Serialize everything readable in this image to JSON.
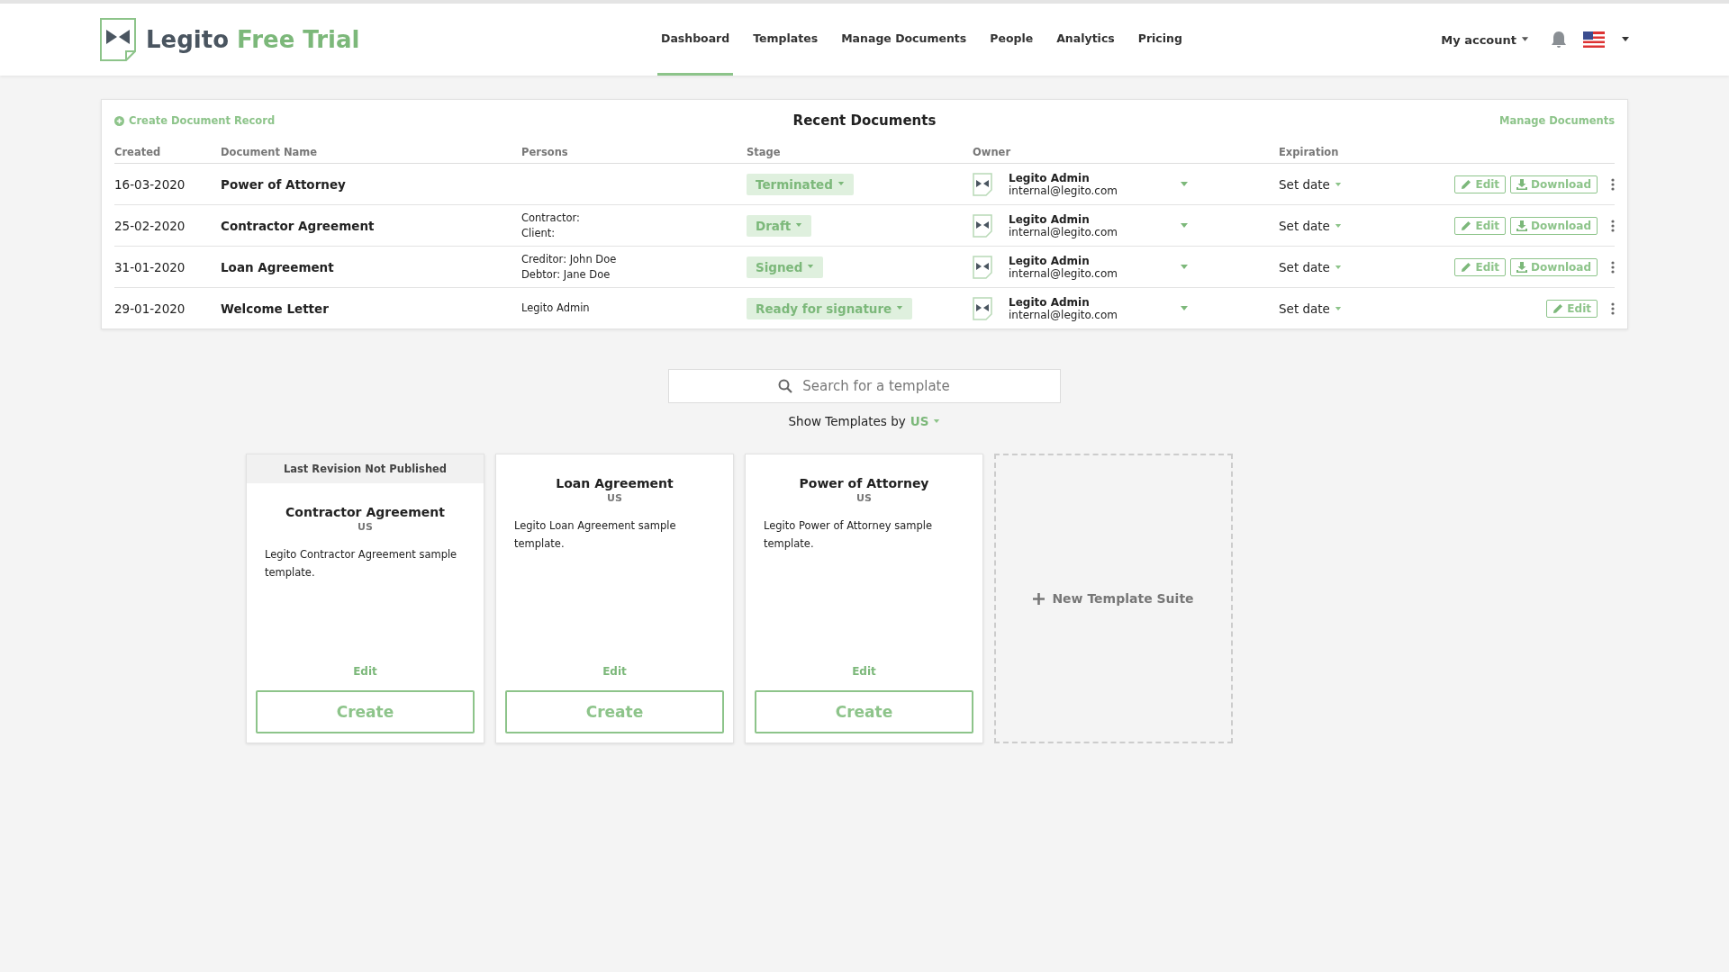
{
  "header": {
    "logo_text": "Legito",
    "logo_accent": "Free Trial",
    "nav": [
      {
        "label": "Dashboard",
        "selected": true
      },
      {
        "label": "Templates",
        "selected": false
      },
      {
        "label": "Manage Documents",
        "selected": false
      },
      {
        "label": "People",
        "selected": false
      },
      {
        "label": "Analytics",
        "selected": false
      },
      {
        "label": "Pricing",
        "selected": false
      }
    ],
    "account": "My account"
  },
  "recent": {
    "create_link": "Create Document Record",
    "title": "Recent Documents",
    "manage_link": "Manage Documents",
    "columns": [
      "Created",
      "Document Name",
      "Persons",
      "Stage",
      "Owner",
      "Expiration"
    ],
    "rows": [
      {
        "created": "16-03-2020",
        "name": "Power of Attorney",
        "persons": [],
        "stage": "Terminated",
        "owner": "Legito Admin",
        "email": "internal@legito.com",
        "expiration": "Set date",
        "actions": [
          {
            "kind": "edit",
            "label": "Edit"
          },
          {
            "kind": "download",
            "label": "Download"
          }
        ]
      },
      {
        "created": "25-02-2020",
        "name": "Contractor Agreement",
        "persons": [
          "Contractor:",
          "Client:"
        ],
        "stage": "Draft",
        "owner": "Legito Admin",
        "email": "internal@legito.com",
        "expiration": "Set date",
        "actions": [
          {
            "kind": "edit",
            "label": "Edit"
          },
          {
            "kind": "download",
            "label": "Download"
          }
        ]
      },
      {
        "created": "31-01-2020",
        "name": "Loan Agreement",
        "persons": [
          "Creditor: John Doe",
          "Debtor: Jane Doe"
        ],
        "stage": "Signed",
        "owner": "Legito Admin",
        "email": "internal@legito.com",
        "expiration": "Set date",
        "actions": [
          {
            "kind": "edit",
            "label": "Edit"
          },
          {
            "kind": "download",
            "label": "Download"
          }
        ]
      },
      {
        "created": "29-01-2020",
        "name": "Welcome Letter",
        "persons": [
          "Legito Admin"
        ],
        "stage": "Ready for signature",
        "owner": "Legito Admin",
        "email": "internal@legito.com",
        "expiration": "Set date",
        "actions": [
          {
            "kind": "edit",
            "label": "Edit"
          }
        ]
      }
    ]
  },
  "search": {
    "placeholder": "Search for a template"
  },
  "filter": {
    "label": "Show Templates by",
    "value": "US"
  },
  "templates": [
    {
      "notice": "Last Revision Not Published",
      "title": "Contractor Agreement",
      "region": "US",
      "description": "Legito Contractor Agreement sample template.",
      "edit": "Edit",
      "create": "Create"
    },
    {
      "title": "Loan Agreement",
      "region": "US",
      "description": "Legito Loan Agreement sample template.",
      "edit": "Edit",
      "create": "Create"
    },
    {
      "title": "Power of Attorney",
      "region": "US",
      "description": "Legito Power of Attorney sample template.",
      "edit": "Edit",
      "create": "Create"
    }
  ],
  "new_suite": "New Template Suite"
}
